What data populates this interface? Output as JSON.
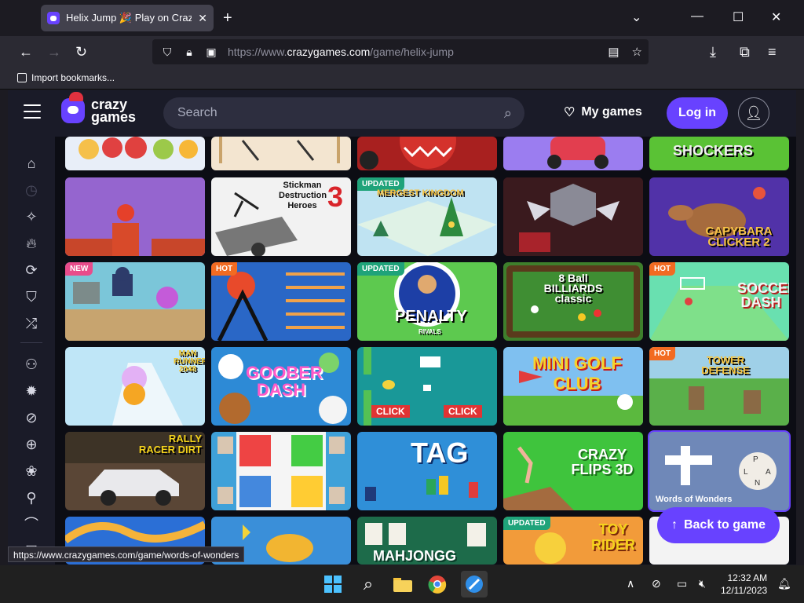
{
  "browser": {
    "tab_title": "Helix Jump 🎉 Play on CrazyGames",
    "url_prefix": "https://www.",
    "url_domain": "crazygames.com",
    "url_path": "/game/helix-jump",
    "bookmark_label": "Import bookmarks..."
  },
  "site": {
    "logo_top": "crazy",
    "logo_bottom": "games",
    "search_placeholder": "Search",
    "my_games_label": "My games",
    "login_label": "Log in",
    "accent_color": "#6842ff"
  },
  "tiles": {
    "row2": [
      {
        "title": "",
        "badge": ""
      },
      {
        "title": "Stickman Destruction Heroes",
        "number": "3",
        "badge": ""
      },
      {
        "title": "MERGEST KINGDOM",
        "badge": "UPDATED"
      },
      {
        "title": "",
        "badge": ""
      },
      {
        "title": "CAPYBARA CLICKER 2",
        "badge": ""
      }
    ],
    "row3": [
      {
        "title": "",
        "badge": "NEW"
      },
      {
        "title": "",
        "badge": "HOT"
      },
      {
        "title": "PENALTY",
        "sub": "RIVALS",
        "badge": "UPDATED"
      },
      {
        "title": "8 Ball BILLIARDS classic",
        "badge": ""
      },
      {
        "title": "SOCCER DASH",
        "badge": "HOT"
      }
    ],
    "row4": [
      {
        "title": "MAN RUNNER 2048",
        "badge": ""
      },
      {
        "title": "GOOBER DASH",
        "badge": ""
      },
      {
        "title": "CLICK",
        "badge": ""
      },
      {
        "title": "MINI GOLF CLUB",
        "badge": ""
      },
      {
        "title": "TOWER DEFENSE",
        "badge": "HOT"
      }
    ],
    "row5": [
      {
        "title": "RALLY RACER DIRT",
        "badge": ""
      },
      {
        "title": "",
        "badge": ""
      },
      {
        "title": "TAG",
        "badge": ""
      },
      {
        "title": "CRAZY FLIPS 3D",
        "badge": ""
      },
      {
        "title": "Words of Wonders",
        "badge": ""
      }
    ],
    "row6": [
      {
        "title": "",
        "badge": ""
      },
      {
        "title": "",
        "badge": ""
      },
      {
        "title": "MAHJONGG",
        "badge": ""
      },
      {
        "title": "TOY RIDER",
        "badge": "UPDATED"
      },
      {
        "title": "",
        "badge": ""
      }
    ]
  },
  "back_to_game_label": "Back to game",
  "status_url": "https://www.crazygames.com/game/words-of-wonders",
  "taskbar": {
    "time": "12:32 AM",
    "date": "12/11/2023"
  }
}
